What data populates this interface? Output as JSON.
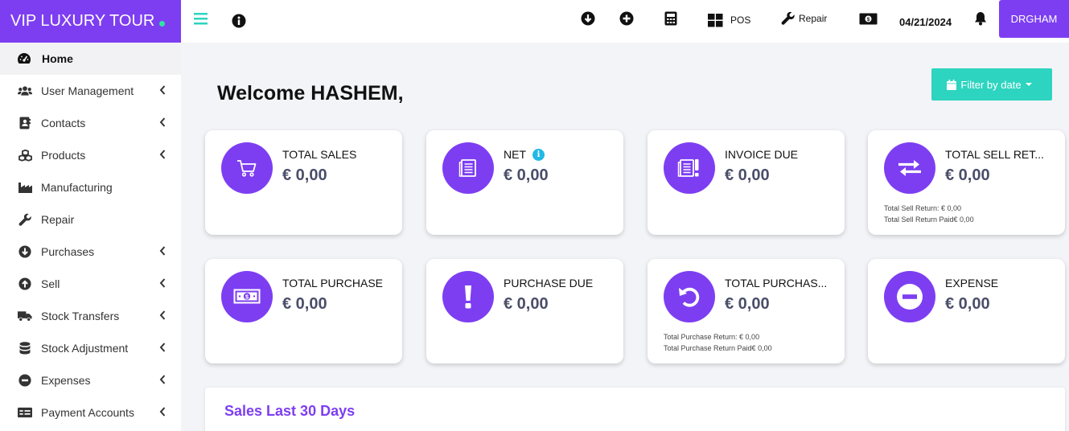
{
  "brand": {
    "name": "VIP LUXURY TOUR",
    "dot_color": "#2ee59d"
  },
  "colors": {
    "accent": "#7d3ef2",
    "teal": "#2dd4bf",
    "info": "#22b8e6"
  },
  "topbar": {
    "icons": [
      "menu-icon",
      "info-icon",
      "download-icon",
      "plus-circle-icon",
      "calculator-icon",
      "pos-grid-icon",
      "wrench-icon",
      "money-icon",
      "bell-icon"
    ],
    "pos_label": "POS",
    "repair_label": "Repair",
    "date": "04/21/2024",
    "user": "DRGHAM"
  },
  "sidebar": {
    "items": [
      {
        "label": "Home",
        "icon": "dashboard-icon",
        "active": true,
        "submenu": false
      },
      {
        "label": "User Management",
        "icon": "users-icon",
        "submenu": true
      },
      {
        "label": "Contacts",
        "icon": "contact-card-icon",
        "submenu": true
      },
      {
        "label": "Products",
        "icon": "cubes-icon",
        "submenu": true
      },
      {
        "label": "Manufacturing",
        "icon": "industry-icon",
        "submenu": false
      },
      {
        "label": "Repair",
        "icon": "wrench-icon",
        "submenu": false
      },
      {
        "label": "Purchases",
        "icon": "arrow-down-circle-icon",
        "submenu": true
      },
      {
        "label": "Sell",
        "icon": "arrow-up-circle-icon",
        "submenu": true
      },
      {
        "label": "Stock Transfers",
        "icon": "truck-icon",
        "submenu": true
      },
      {
        "label": "Stock Adjustment",
        "icon": "database-icon",
        "submenu": true
      },
      {
        "label": "Expenses",
        "icon": "minus-circle-icon",
        "submenu": true
      },
      {
        "label": "Payment Accounts",
        "icon": "money-check-icon",
        "submenu": true
      }
    ]
  },
  "main": {
    "welcome": "Welcome HASHEM,",
    "filter_label": "Filter by date",
    "cards": [
      {
        "title": "TOTAL SALES",
        "value": "€ 0,00",
        "icon": "cart-icon"
      },
      {
        "title": "NET",
        "value": "€ 0,00",
        "icon": "ledger-icon",
        "info": "i"
      },
      {
        "title": "INVOICE DUE",
        "value": "€ 0,00",
        "icon": "invoice-alert-icon"
      },
      {
        "title": "TOTAL SELL RET...",
        "value": "€ 0,00",
        "icon": "exchange-icon",
        "notes": [
          "Total Sell Return: € 0,00",
          "Total Sell Return Paid€ 0,00"
        ]
      },
      {
        "title": "TOTAL PURCHASE",
        "value": "€ 0,00",
        "icon": "money-bill-icon"
      },
      {
        "title": "PURCHASE DUE",
        "value": "€ 0,00",
        "icon": "exclamation-icon"
      },
      {
        "title": "TOTAL PURCHAS...",
        "value": "€ 0,00",
        "icon": "undo-icon",
        "notes": [
          "Total Purchase Return: € 0,00",
          "Total Purchase Return Paid€ 0,00"
        ]
      },
      {
        "title": "EXPENSE",
        "value": "€ 0,00",
        "icon": "minus-circle-icon"
      }
    ],
    "chart_title": "Sales Last 30 Days"
  }
}
